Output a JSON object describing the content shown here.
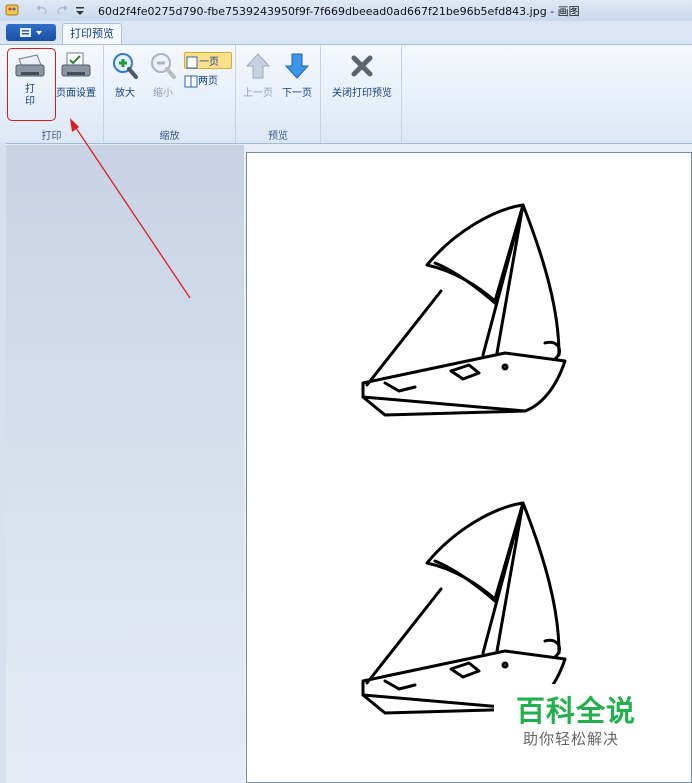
{
  "window": {
    "title": "60d2f4fe0275d790-fbe7539243950f9f-7f669dbeead0ad667f21be96b5efd843.jpg - 画图"
  },
  "tabs": [
    {
      "label": "打印预览"
    }
  ],
  "ribbon": {
    "print_group": {
      "label": "打印",
      "print": "打\n印",
      "page_setup": "页面设置"
    },
    "zoom_group": {
      "label": "缩放",
      "zoom_in": "放大",
      "zoom_out": "缩小",
      "one_page": "一页",
      "two_pages": "两页"
    },
    "preview_group": {
      "label": "预览",
      "prev_page": "上一页",
      "next_page": "下一页"
    },
    "close_group": {
      "close_preview": "关闭打印预览"
    }
  },
  "watermark": {
    "title": "百科全说",
    "subtitle": "助你轻松解决"
  },
  "colors": {
    "accent": "#15428b",
    "highlight": "#cc2020",
    "watermark_green": "#22b04d"
  }
}
